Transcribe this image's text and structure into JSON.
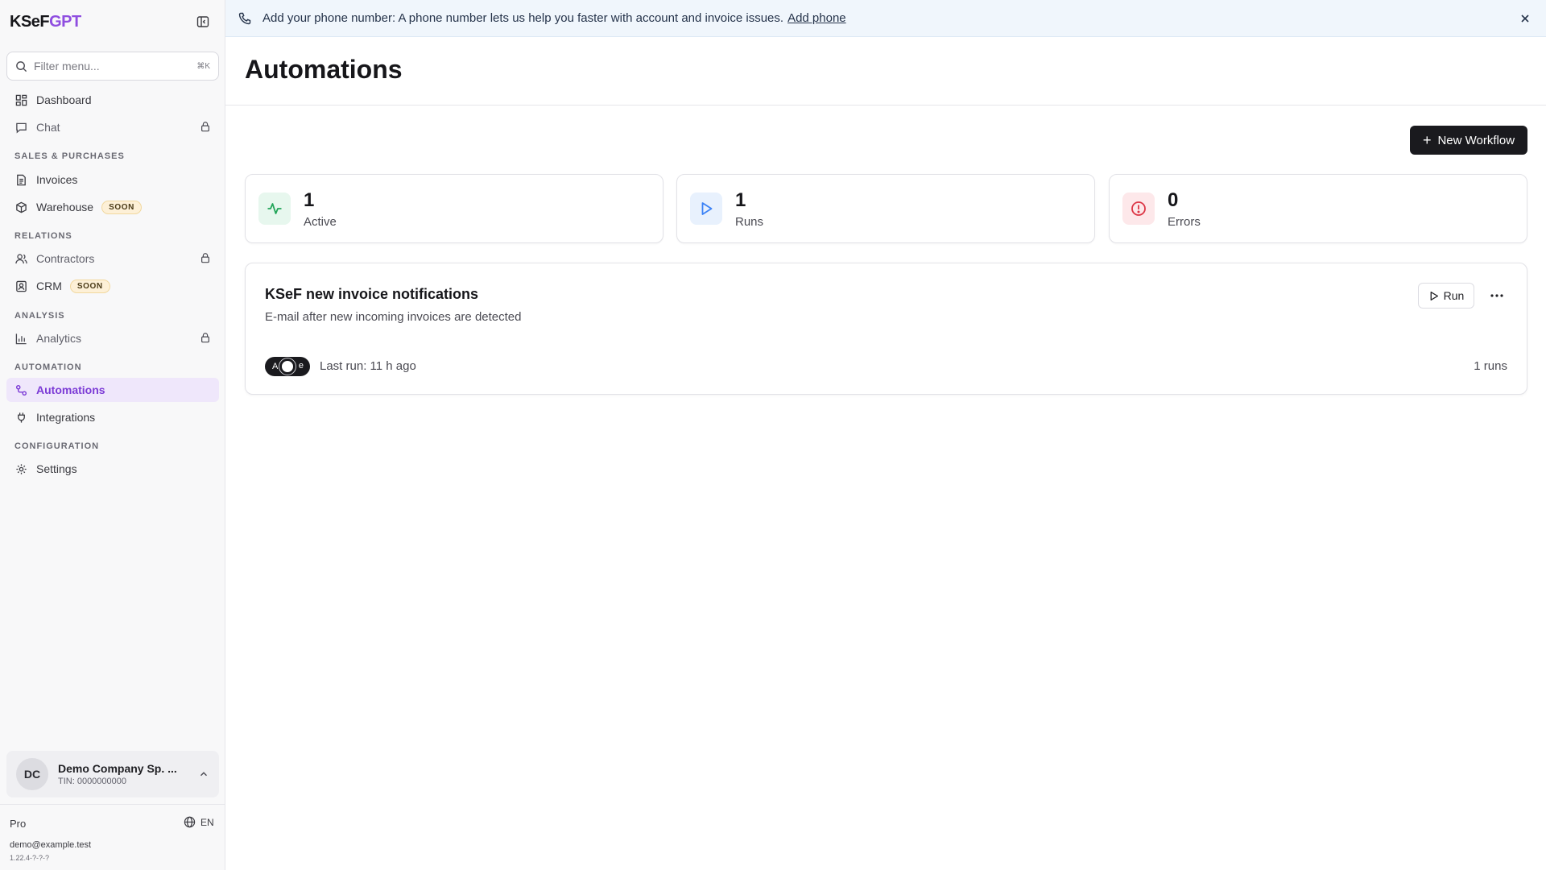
{
  "app": {
    "brand_prefix": "KSeF",
    "brand_suffix": "GPT"
  },
  "sidebar": {
    "filter_placeholder": "Filter menu...",
    "filter_shortcut": "⌘K",
    "items": {
      "dashboard": "Dashboard",
      "chat": "Chat",
      "invoices": "Invoices",
      "warehouse": "Warehouse",
      "contractors": "Contractors",
      "crm": "CRM",
      "analytics": "Analytics",
      "automations": "Automations",
      "integrations": "Integrations",
      "settings": "Settings"
    },
    "soon_badge": "SOON",
    "sections": {
      "sales": "SALES & PURCHASES",
      "relations": "RELATIONS",
      "analysis": "ANALYSIS",
      "automation": "AUTOMATION",
      "configuration": "CONFIGURATION"
    },
    "company": {
      "initials": "DC",
      "name": "Demo Company Sp. ...",
      "tin": "TIN: 0000000000"
    },
    "plan": "Pro",
    "language": "EN",
    "email": "demo@example.test",
    "version": "1.22.4-?-?-?"
  },
  "banner": {
    "message": "Add your phone number: A phone number lets us help you faster with account and invoice issues.",
    "link": "Add phone"
  },
  "main": {
    "title": "Automations",
    "new_workflow_label": "New Workflow",
    "stats": [
      {
        "value": "1",
        "label": "Active"
      },
      {
        "value": "1",
        "label": "Runs"
      },
      {
        "value": "0",
        "label": "Errors"
      }
    ],
    "workflow": {
      "title": "KSeF new invoice notifications",
      "description": "E-mail after new incoming invoices are detected",
      "run_label": "Run",
      "toggle_text_left": "A",
      "toggle_text_right": "e",
      "last_run": "Last run: 11 h ago",
      "runs": "1 runs"
    }
  },
  "colors": {
    "accent": "#7c3bd6",
    "active_badge_bg": "#e7f7ee",
    "active_icon": "#22a559",
    "runs_badge_bg": "#e8f1fd",
    "runs_icon": "#3b82f6",
    "errors_badge_bg": "#fde8ea",
    "errors_icon": "#dc3545"
  },
  "icons": {
    "collapse": "sidebar-collapse-icon",
    "search": "search-icon",
    "dashboard": "dashboard-icon",
    "chat": "chat-icon",
    "lock": "lock-icon",
    "invoices": "invoice-icon",
    "warehouse": "box-icon",
    "contractors": "users-icon",
    "crm": "contact-icon",
    "analytics": "bar-chart-icon",
    "automations": "workflow-icon",
    "integrations": "plug-icon",
    "settings": "gear-icon",
    "phone": "phone-icon",
    "close": "close-icon",
    "globe": "globe-icon",
    "chevron": "chevron-up-icon",
    "activity": "activity-icon",
    "play": "play-icon",
    "alert": "alert-circle-icon",
    "more": "more-horizontal-icon"
  }
}
